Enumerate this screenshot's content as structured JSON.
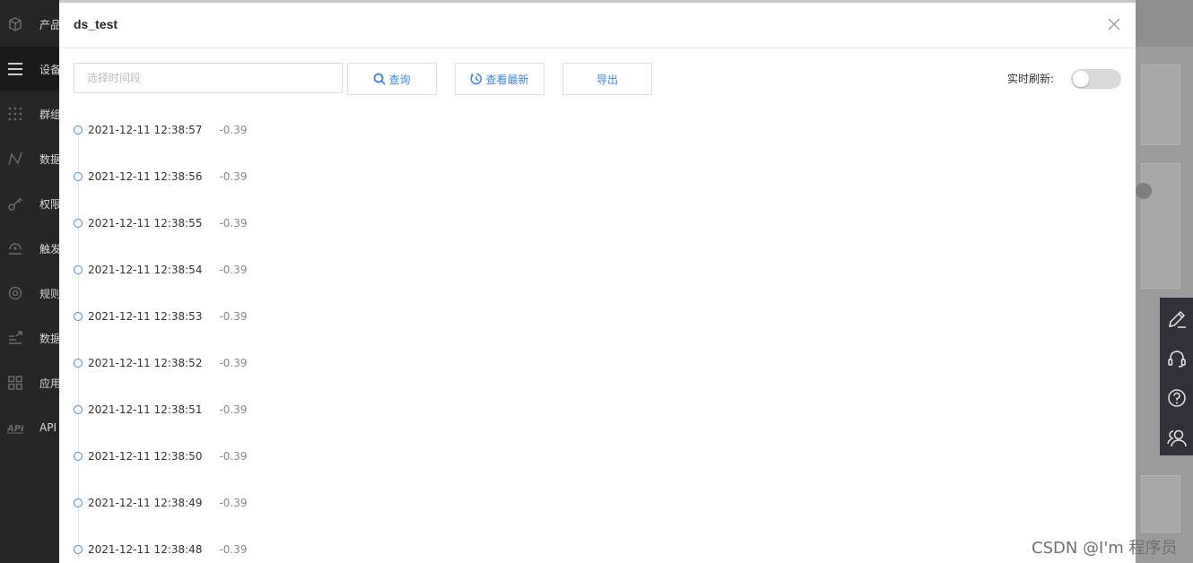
{
  "sidebar": {
    "items": [
      {
        "label": "产品",
        "icon": "box-icon"
      },
      {
        "label": "设备",
        "icon": "menu-icon"
      },
      {
        "label": "群组",
        "icon": "grid-icon"
      },
      {
        "label": "数据",
        "icon": "chart-line-icon"
      },
      {
        "label": "权限",
        "icon": "key-icon"
      },
      {
        "label": "触发",
        "icon": "trigger-icon"
      },
      {
        "label": "规则",
        "icon": "rule-icon"
      },
      {
        "label": "数据",
        "icon": "data-export-icon"
      },
      {
        "label": "应用",
        "icon": "apps-icon"
      },
      {
        "label": "API",
        "icon": "api-icon"
      }
    ]
  },
  "modal": {
    "title": "ds_test",
    "date_placeholder": "选择时间段",
    "query_label": "查询",
    "latest_label": "查看最新",
    "export_label": "导出",
    "realtime_label": "实时刷新:",
    "realtime_on": false
  },
  "timeline": {
    "items": [
      {
        "time": "2021-12-11 12:38:57",
        "value": "-0.39"
      },
      {
        "time": "2021-12-11 12:38:56",
        "value": "-0.39"
      },
      {
        "time": "2021-12-11 12:38:55",
        "value": "-0.39"
      },
      {
        "time": "2021-12-11 12:38:54",
        "value": "-0.39"
      },
      {
        "time": "2021-12-11 12:38:53",
        "value": "-0.39"
      },
      {
        "time": "2021-12-11 12:38:52",
        "value": "-0.39"
      },
      {
        "time": "2021-12-11 12:38:51",
        "value": "-0.39"
      },
      {
        "time": "2021-12-11 12:38:50",
        "value": "-0.39"
      },
      {
        "time": "2021-12-11 12:38:49",
        "value": "-0.39"
      },
      {
        "time": "2021-12-11 12:38:48",
        "value": "-0.39"
      }
    ]
  },
  "tools": [
    "edit-icon",
    "headset-icon",
    "help-icon",
    "users-icon"
  ],
  "watermark": "CSDN @I'm 程序员",
  "colors": {
    "accent": "#3a86e6",
    "sidebar": "#262626",
    "toolbox": "#2f3238"
  }
}
